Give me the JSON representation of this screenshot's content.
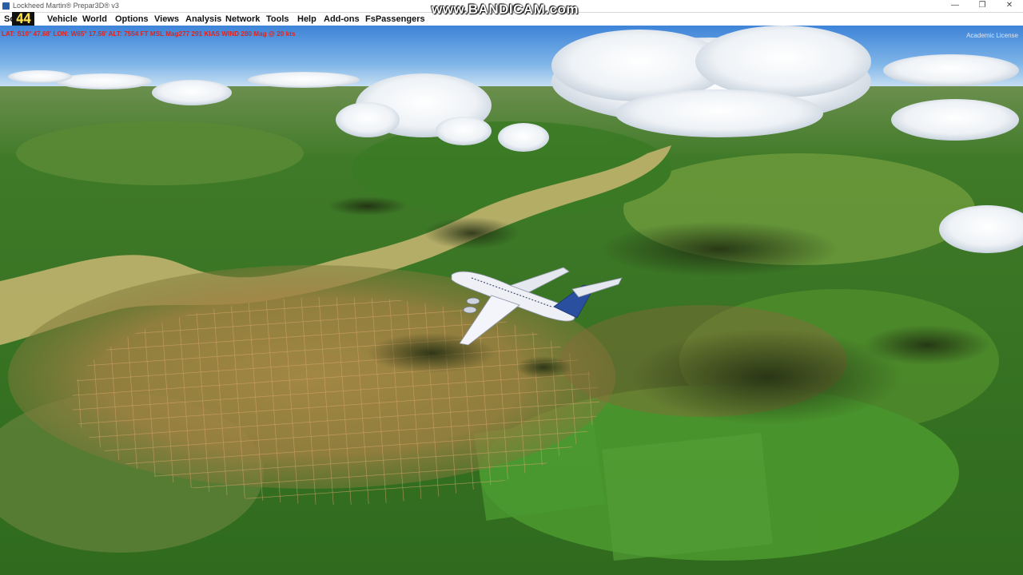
{
  "window": {
    "title": "Lockheed Martin® Prepar3D® v3",
    "controls": {
      "minimize": "—",
      "maximize": "❐",
      "close": "✕"
    }
  },
  "menu": {
    "items": [
      {
        "id": "scenario",
        "label": "Sc   o"
      },
      {
        "id": "vehicle",
        "label": "Vehicle"
      },
      {
        "id": "world",
        "label": "World"
      },
      {
        "id": "options",
        "label": "Options"
      },
      {
        "id": "views",
        "label": "Views"
      },
      {
        "id": "analysis",
        "label": "Analysis"
      },
      {
        "id": "network",
        "label": "Network"
      },
      {
        "id": "tools",
        "label": "Tools"
      },
      {
        "id": "help",
        "label": "Help"
      },
      {
        "id": "addons",
        "label": "Add-ons"
      },
      {
        "id": "fspassengers",
        "label": "FsPassengers"
      }
    ]
  },
  "fps": "44",
  "recorder_watermark": "www.BANDICAM.com",
  "status": "LAT: S10° 47.68'  LON: W65° 17.56'  ALT: 7554 FT  MSL   Mag277  291 KIAS  WIND 280 Mag @ 20 kts",
  "license": "Academic License",
  "colors": {
    "status_text": "#e0231c",
    "fps_text": "#ffe14a",
    "menu_bg": "#ffffff",
    "sky_top": "#3d83d8",
    "sky_horizon": "#cfe4f4",
    "aircraft_body": "#eef0f6",
    "aircraft_tail": "#2a4f9e"
  },
  "scene": {
    "description_icon": "flight-scene"
  }
}
